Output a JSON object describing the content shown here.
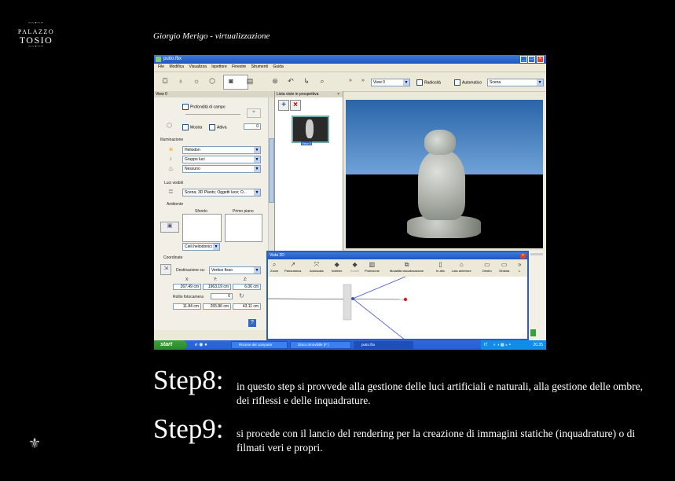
{
  "logo": {
    "line1": "PALAZZO",
    "line2": "TOSIO"
  },
  "author": "Giorgio Merigo - virtualizzazione",
  "window": {
    "title": "putto.fbx",
    "menu": [
      "File",
      "Modifica",
      "Visualizza",
      "Ispettore",
      "Finestre",
      "Strumenti",
      "Guida"
    ],
    "view_combo": "View 0",
    "radiosity": "Radiosità",
    "automatic": "Automatico",
    "scene_combo": "Scena"
  },
  "left_panel": {
    "header": "View 0",
    "depth_of_field": "Profondità di campo",
    "show": "Mostra",
    "active": "Attiva",
    "active_value": "0",
    "lighting_title": "Illuminazione",
    "heliodon": "Heliodon",
    "light_group": "Gruppo luci",
    "none": "Nessuno",
    "visible_lights_title": "Luci visibili",
    "visible_lights": "Scena; 3D Plants; Oggetti luce; O...",
    "environment_title": "Ambiente",
    "background": "Sfondo",
    "foreground": "Primo piano",
    "sky": "Cieli heliodonici",
    "coordinates_title": "Coordinate",
    "destination_label": "Destinazione su:",
    "destination_value": "Vertice fisso",
    "x_label": "X:",
    "y_label": "Y:",
    "z_label": "Z:",
    "x1": "267.49 cm",
    "y1": "1963.19 cm",
    "z1": "6.06 cm",
    "roll_label": "Rollio fotocamera",
    "roll_value": "0",
    "x2": "11.84 cm",
    "y2": "265.86 cm",
    "z2": "43.11 cm"
  },
  "list_panel": {
    "header": "Lista viste in prospettiva",
    "thumb_caption": "View 0"
  },
  "vista2d": {
    "title": "Vista 2D",
    "tools": [
      "Zoom",
      "Panoramica",
      "Autoscala",
      "Indietro",
      "Avanti",
      "Proiezione",
      "Modalità visualizzazione",
      "In alto",
      "Lato anteriore",
      "Destro",
      "Sinistra",
      "L"
    ]
  },
  "taskbar": {
    "start": "start",
    "tasks": [
      "Risorse del computer",
      "Disco rimovibile (F:)",
      "putto.fbx"
    ],
    "lang": "IT",
    "time": "20.35"
  },
  "steps": [
    {
      "label": "Step8:",
      "text": "in questo step si provvede alla gestione delle luci artificiali e naturali, alla gestione delle ombre, dei riflessi e delle inquadrature."
    },
    {
      "label": "Step9:",
      "text": "si procede con il lancio del rendering per la creazione di immagini statiche (inquadrature) o di filmati veri e propri."
    }
  ]
}
